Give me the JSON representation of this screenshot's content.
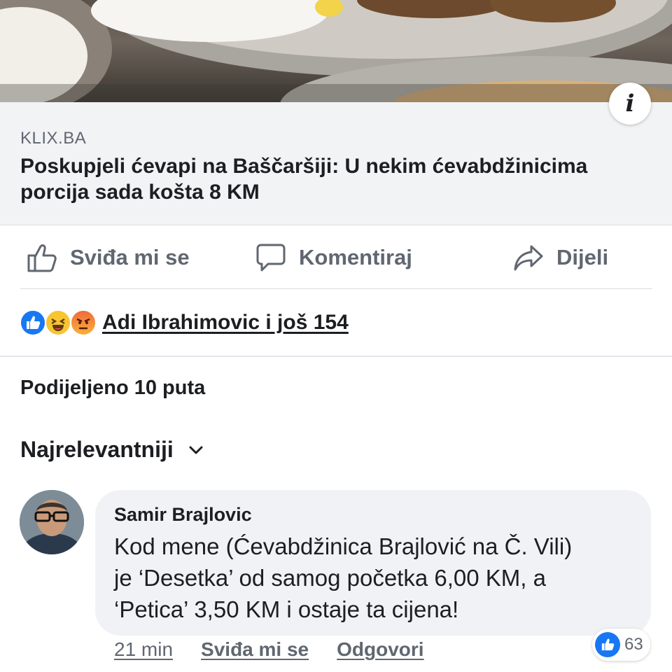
{
  "post": {
    "info_icon": "info-icon",
    "link": {
      "domain": "KLIX.BA",
      "title": "Poskupjeli ćevapi na Baščaršiji: U nekim ćevabdžinicima porcija sada košta 8 KM"
    },
    "actions": {
      "like_label": "Sviđa mi se",
      "comment_label": "Komentiraj",
      "share_label": "Dijeli"
    },
    "reactions": {
      "icons": [
        "like",
        "haha",
        "angry"
      ],
      "summary": "Adi Ibrahimovic i još 154"
    },
    "shares": "Podijeljeno 10 puta",
    "sort_label": "Najrelevantniji"
  },
  "comment": {
    "author": "Samir Brajlovic",
    "lines": [
      "Kod mene (Ćevabdžinica Brajlović na Č. Vili)",
      "je ‘Desetka’ od samog početka 6,00 KM, a",
      "‘Petica’ 3,50 KM i ostaje ta cijena!"
    ],
    "time": "21 min",
    "like_label": "Sviđa mi se",
    "reply_label": "Odgovori",
    "like_count": "63"
  },
  "colors": {
    "brand_blue": "#1877f2",
    "secondary_text": "#606770",
    "card_bg": "#f2f3f5",
    "bubble_bg": "#f0f2f5"
  }
}
